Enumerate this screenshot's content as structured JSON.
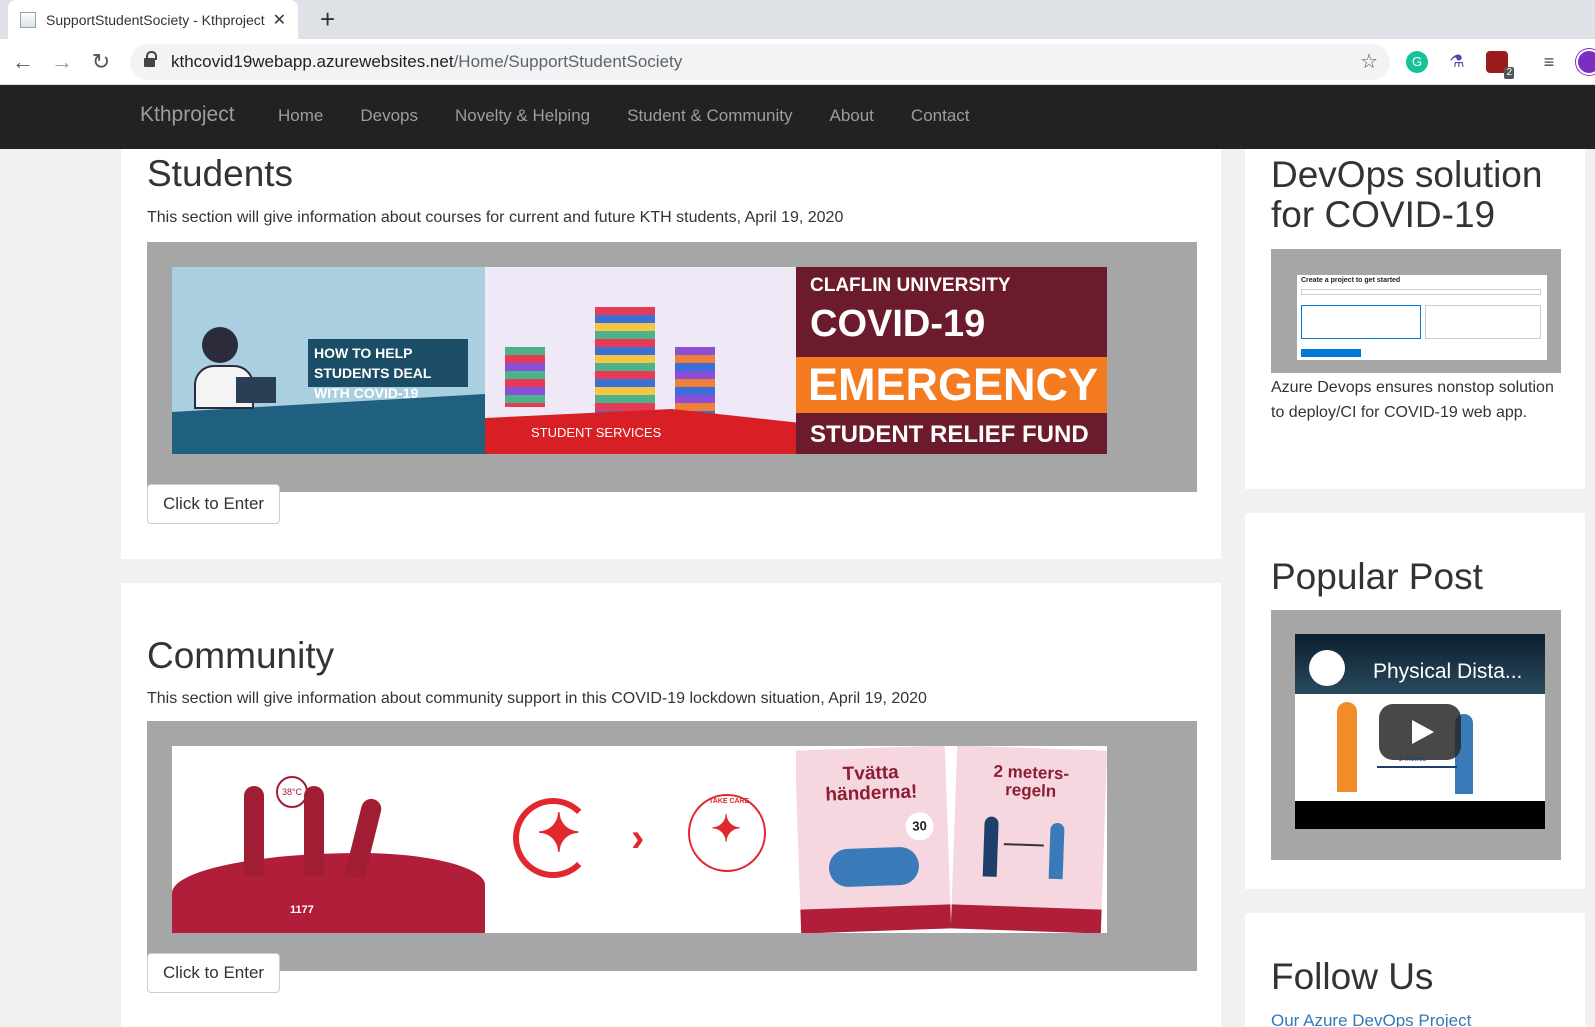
{
  "browser": {
    "tab_title": "SupportStudentSociety - Kthproject",
    "url_domain": "kthcovid19webapp.azurewebsites.net",
    "url_path": "/Home/SupportStudentSociety",
    "ext_badge": "2"
  },
  "nav": {
    "brand": "Kthproject",
    "links": [
      "Home",
      "Devops",
      "Novelty & Helping",
      "Student & Community",
      "About",
      "Contact"
    ]
  },
  "students": {
    "title": "Students",
    "description": "This section will give information about courses for current and future KTH students, April 19, 2020",
    "button": "Click to Enter",
    "images": {
      "img1_text": "HOW TO HELP STUDENTS DEAL WITH COVID-19",
      "img2_text": "STUDENT SERVICES",
      "img3_line1": "CLAFLIN UNIVERSITY",
      "img3_line2": "COVID-19",
      "img3_line3": "EMERGENCY",
      "img3_line4": "STUDENT RELIEF FUND"
    }
  },
  "community": {
    "title": "Community",
    "description": "This section will give information about community support in this COVID-19 lockdown situation, April 19, 2020",
    "button": "Click to Enter",
    "images": {
      "img1_text": "38°C",
      "img1_footer": "1177",
      "img2_text": "TAKE CARE",
      "img3_left": "Tvätta händerna!",
      "img3_right": "2 meters-regeln",
      "img3_badge": "30"
    }
  },
  "sidebar": {
    "devops_title": "DevOps solution for COVID-19",
    "devops_text": "Azure Devops ensures nonstop solution to deploy/CI for COVID-19 web app.",
    "devops_shot_title": "Create a project to get started",
    "popular_title": "Popular Post",
    "video_title": "Physical Dista...",
    "video_label": "2 metres",
    "follow_title": "Follow Us",
    "follow_link": "Our Azure DevOps Project"
  }
}
